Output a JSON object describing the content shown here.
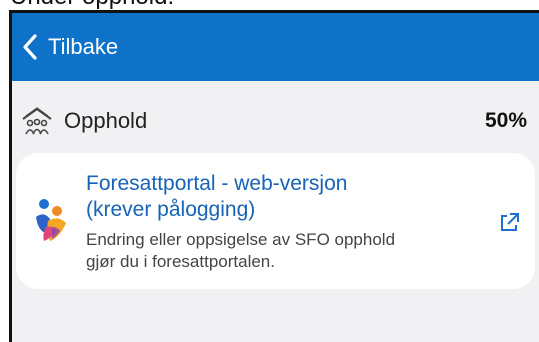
{
  "caption": "Under opphold:",
  "navbar": {
    "back_label": "Tilbake"
  },
  "row": {
    "label": "Opphold",
    "value": "50%"
  },
  "card": {
    "link_line1": "Foresattportal - web-versjon",
    "link_line2": "(krever pålogging)",
    "desc_line1": "Endring eller oppsigelse av SFO opphold",
    "desc_line2": "gjør du i foresattportalen."
  },
  "colors": {
    "navbar": "#0f72c9",
    "link": "#1863b6",
    "background": "#f1f1f4"
  },
  "icons": [
    "chevron-left-icon",
    "house-people-icon",
    "family-logo-icon",
    "external-link-icon"
  ]
}
